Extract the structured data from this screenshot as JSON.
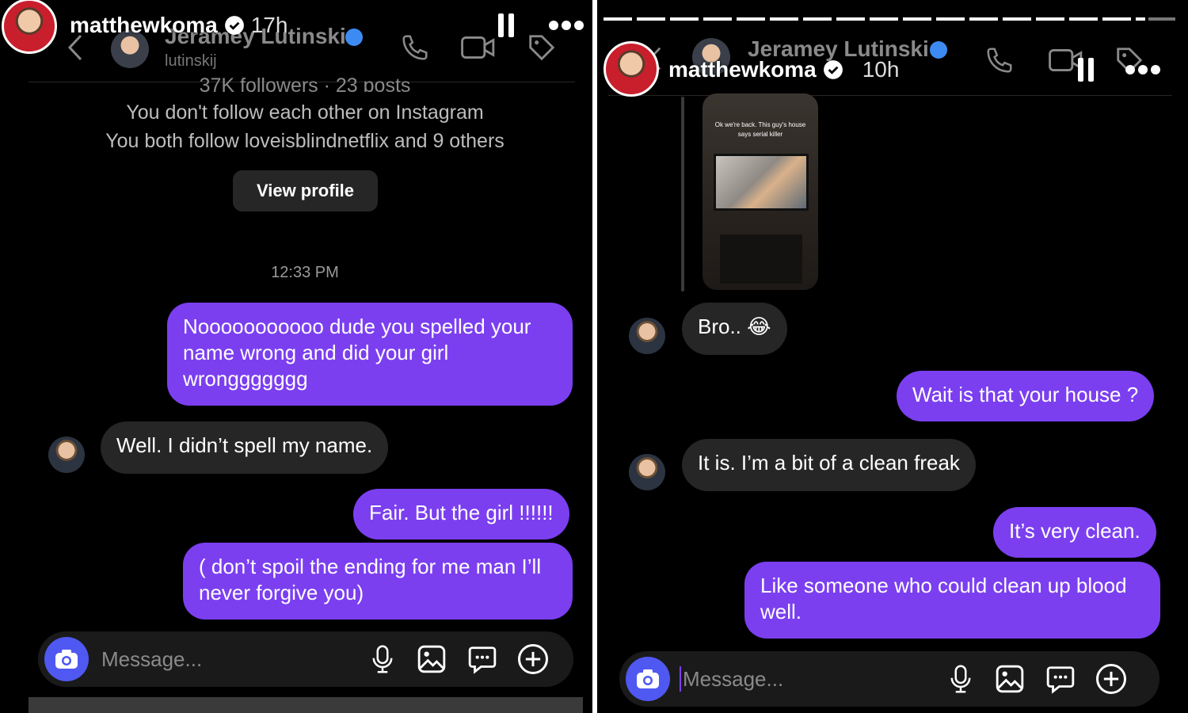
{
  "left": {
    "story_user": "matthewkoma",
    "story_time": "17h",
    "contact_name": "Jeramey Lutinski",
    "contact_handle": "lutinskij",
    "followers_line": "37K followers · 23 posts",
    "follow_status": "You don't follow each other on Instagram",
    "mutual_line": "You both follow loveisblindnetflix and 9 others",
    "view_profile": "View profile",
    "timestamp": "12:33 PM",
    "messages": [
      {
        "from": "me",
        "text": "Nooooooooooo dude you spelled your name wrong and did your girl wronggggggg"
      },
      {
        "from": "them",
        "text": "Well. I didn’t spell my name."
      },
      {
        "from": "me",
        "text": "Fair. But the girl !!!!!!"
      },
      {
        "from": "me",
        "text": "( don’t spoil the ending for me man I’ll never forgive you)"
      }
    ],
    "composer_placeholder": "Message..."
  },
  "right": {
    "story_user": "matthewkoma",
    "story_time": "10h",
    "contact_name": "Jeramey Lutinski",
    "shared_caption": "Ok we're back. This guy's house says serial killer",
    "messages": [
      {
        "from": "them",
        "text": "Bro.. 😂"
      },
      {
        "from": "me",
        "text": "Wait is that your house ?"
      },
      {
        "from": "them",
        "text": "It is. I’m a bit of a clean freak"
      },
      {
        "from": "me",
        "text": "It’s very clean."
      },
      {
        "from": "me",
        "text": "Like someone who could clean up blood well."
      }
    ],
    "composer_placeholder": "Message..."
  },
  "colors": {
    "outgoing_bubble": "#7b3ff0",
    "incoming_bubble": "#262626",
    "camera_button": "#4f58f0",
    "verified": "#3d8bf2"
  },
  "icons": [
    "back-chevron-icon",
    "phone-icon",
    "video-icon",
    "tag-icon",
    "pause-icon",
    "more-icon",
    "camera-icon",
    "mic-icon",
    "gallery-icon",
    "sticker-icon",
    "plus-icon"
  ]
}
